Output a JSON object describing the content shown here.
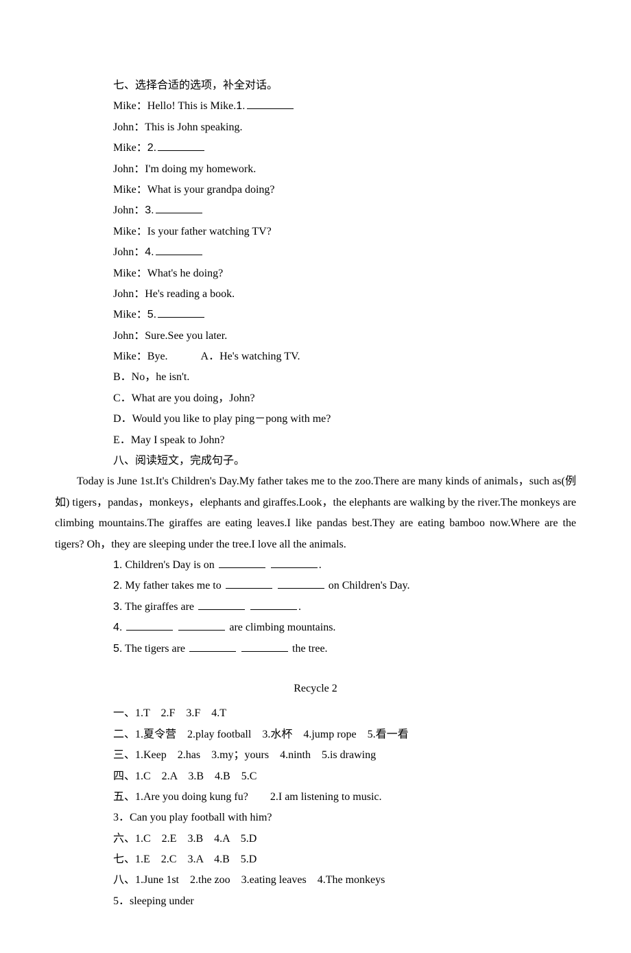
{
  "section7": {
    "heading": "七、选择合适的选项，补全对话。",
    "lines": [
      "Mike：Hello! This is Mike.",
      "John：This is John speaking.",
      "Mike：",
      "John：I'm doing my homework.",
      "Mike：What is your grandpa doing?",
      "John：",
      "Mike：Is your father watching TV?",
      "John：",
      "Mike：What's he doing?",
      "John：He's reading a book.",
      "Mike：",
      "John：Sure.See you later.",
      "Mike：Bye.　　　A．He's watching TV."
    ],
    "nums": {
      "n1": "1.",
      "n2": "2.",
      "n3": "3.",
      "n4": "4.",
      "n5": "5."
    },
    "options": [
      "B．No，he isn't.",
      "C．What are you doing，John?",
      "D．Would you like to play ping－pong with me?",
      "E．May I speak to John?"
    ]
  },
  "section8": {
    "heading": "八、阅读短文，完成句子。",
    "passage": "Today is June 1st.It's Children's Day.My father takes me to the zoo.There are many kinds of animals，such as(例如) tigers，pandas，monkeys，elephants and giraffes.Look，the elephants are walking by the river.The monkeys are climbing mountains.The giraffes are eating leaves.I like pandas best.They are eating bamboo now.Where are the tigers? Oh，they are sleeping under the tree.I love all the animals.",
    "q1": {
      "num": "1.",
      "a": " Children's Day is on ",
      "b": "."
    },
    "q2": {
      "num": "2.",
      "a": " My father takes me to ",
      "b": " on Children's Day."
    },
    "q3": {
      "num": "3.",
      "a": " The giraffes are ",
      "b": "."
    },
    "q4": {
      "num": "4.",
      "a": " ",
      "b": " are climbing mountains."
    },
    "q5": {
      "num": "5.",
      "a": " The tigers are ",
      "b": " the tree."
    }
  },
  "answers": {
    "title": "Recycle 2",
    "a1": "一、1.T　2.F　3.F　4.T",
    "a2": "二、1.夏令营　2.play football　3.水杯　4.jump rope　5.看一看",
    "a3": "三、1.Keep　2.has　3.my；yours　4.ninth　5.is drawing",
    "a4": "四、1.C　2.A　3.B　4.B　5.C",
    "a5": "五、1.Are you doing kung fu?　　2.I am listening to music.",
    "a5b": "3．Can you play football with him?",
    "a6": "六、1.C　2.E　3.B　4.A　5.D",
    "a7": "七、1.E　2.C　3.A　4.B　5.D",
    "a8": "八、1.June 1st　2.the zoo　3.eating leaves　4.The monkeys",
    "a8b": "5．sleeping under"
  }
}
